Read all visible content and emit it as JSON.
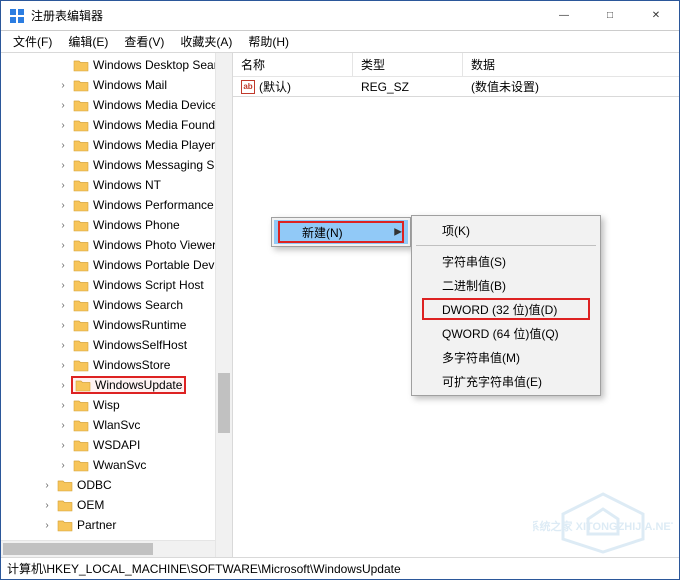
{
  "title": "注册表编辑器",
  "window_buttons": {
    "min": "—",
    "max": "□",
    "close": "✕"
  },
  "menu": [
    "文件(F)",
    "编辑(E)",
    "查看(V)",
    "收藏夹(A)",
    "帮助(H)"
  ],
  "tree": {
    "items": [
      {
        "label": "Windows Desktop Searc",
        "depth": 3,
        "arrow": "none"
      },
      {
        "label": "Windows Mail",
        "depth": 3,
        "arrow": "collapsed"
      },
      {
        "label": "Windows Media Device",
        "depth": 3,
        "arrow": "collapsed"
      },
      {
        "label": "Windows Media Founda",
        "depth": 3,
        "arrow": "collapsed"
      },
      {
        "label": "Windows Media Player I",
        "depth": 3,
        "arrow": "collapsed"
      },
      {
        "label": "Windows Messaging Su",
        "depth": 3,
        "arrow": "collapsed"
      },
      {
        "label": "Windows NT",
        "depth": 3,
        "arrow": "collapsed"
      },
      {
        "label": "Windows Performance T",
        "depth": 3,
        "arrow": "collapsed"
      },
      {
        "label": "Windows Phone",
        "depth": 3,
        "arrow": "collapsed"
      },
      {
        "label": "Windows Photo Viewer",
        "depth": 3,
        "arrow": "collapsed"
      },
      {
        "label": "Windows Portable Devic",
        "depth": 3,
        "arrow": "collapsed"
      },
      {
        "label": "Windows Script Host",
        "depth": 3,
        "arrow": "collapsed"
      },
      {
        "label": "Windows Search",
        "depth": 3,
        "arrow": "collapsed"
      },
      {
        "label": "WindowsRuntime",
        "depth": 3,
        "arrow": "collapsed"
      },
      {
        "label": "WindowsSelfHost",
        "depth": 3,
        "arrow": "collapsed"
      },
      {
        "label": "WindowsStore",
        "depth": 3,
        "arrow": "collapsed"
      },
      {
        "label": "WindowsUpdate",
        "depth": 3,
        "arrow": "collapsed",
        "selected": true
      },
      {
        "label": "Wisp",
        "depth": 3,
        "arrow": "collapsed"
      },
      {
        "label": "WlanSvc",
        "depth": 3,
        "arrow": "collapsed"
      },
      {
        "label": "WSDAPI",
        "depth": 3,
        "arrow": "collapsed"
      },
      {
        "label": "WwanSvc",
        "depth": 3,
        "arrow": "collapsed"
      },
      {
        "label": "ODBC",
        "depth": 2,
        "arrow": "collapsed"
      },
      {
        "label": "OEM",
        "depth": 2,
        "arrow": "collapsed"
      },
      {
        "label": "Partner",
        "depth": 2,
        "arrow": "collapsed"
      }
    ]
  },
  "list": {
    "columns": {
      "name": "名称",
      "type": "类型",
      "data": "数据"
    },
    "rows": [
      {
        "name": "(默认)",
        "type": "REG_SZ",
        "data": "(数值未设置)"
      }
    ]
  },
  "context_menu": {
    "primary": {
      "label": "新建(N)"
    },
    "submenu": [
      {
        "label": "项(K)"
      },
      {
        "label": "字符串值(S)"
      },
      {
        "label": "二进制值(B)"
      },
      {
        "label": "DWORD (32 位)值(D)",
        "highlight": true
      },
      {
        "label": "QWORD (64 位)值(Q)"
      },
      {
        "label": "多字符串值(M)"
      },
      {
        "label": "可扩充字符串值(E)"
      }
    ]
  },
  "statusbar": "计算机\\HKEY_LOCAL_MACHINE\\SOFTWARE\\Microsoft\\WindowsUpdate",
  "watermark": "系统之家 XITONGZHIJIA.NET",
  "colors": {
    "highlight_box": "#d22",
    "menu_hover": "#91c9f7",
    "folder": "#f7c55a",
    "folder_dark": "#d6a33a"
  }
}
